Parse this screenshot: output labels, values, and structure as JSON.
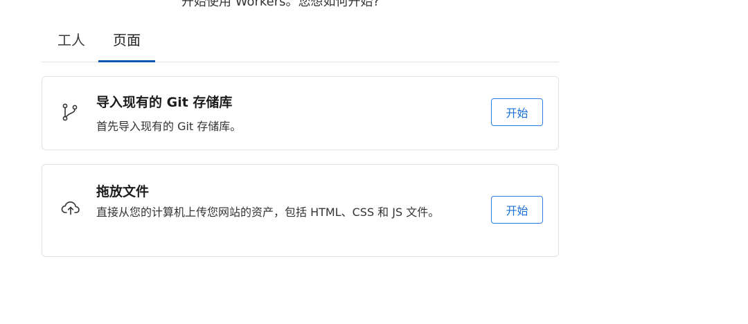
{
  "header": {
    "intro_text": "开始使用 Workers。您想如何开始?"
  },
  "tabs": [
    {
      "label": "工人",
      "active": false
    },
    {
      "label": "页面",
      "active": true
    }
  ],
  "options": [
    {
      "title": "导入现有的 Git 存储库",
      "description": "首先导入现有的 Git 存储库。",
      "button_label": "开始",
      "icon": "git-branch-icon"
    },
    {
      "title": "拖放文件",
      "description": "直接从您的计算机上传您网站的资产，包括 HTML、CSS 和 JS 文件。",
      "button_label": "开始",
      "icon": "cloud-upload-icon"
    }
  ],
  "colors": {
    "accent": "#0a56b3",
    "button_border": "#2c7be5",
    "button_text": "#1a6fd8",
    "card_border": "#e1e1e1"
  }
}
